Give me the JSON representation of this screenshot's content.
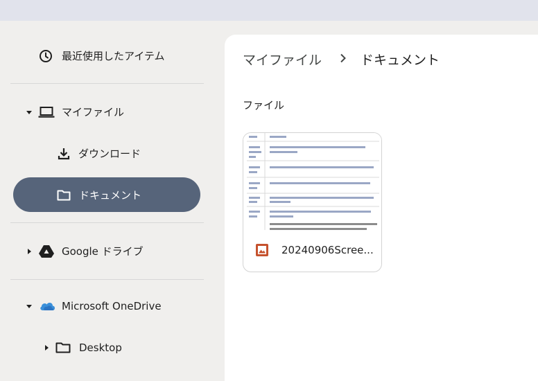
{
  "sidebar": {
    "recent": {
      "label": "最近使用したアイテム",
      "icon": "clock-icon"
    },
    "my_files": {
      "label": "マイファイル",
      "icon": "laptop-icon"
    },
    "downloads": {
      "label": "ダウンロード",
      "icon": "download-icon"
    },
    "documents": {
      "label": "ドキュメント",
      "icon": "folder-icon",
      "active": true
    },
    "google_drive": {
      "label": "Google ドライブ",
      "icon": "google-drive-icon"
    },
    "onedrive": {
      "label": "Microsoft OneDrive",
      "icon": "cloud-icon"
    },
    "desktop": {
      "label": "Desktop",
      "icon": "folder-icon"
    }
  },
  "main": {
    "breadcrumb": [
      "マイファイル",
      "ドキュメント"
    ],
    "section_label": "ファイル",
    "files": [
      {
        "name": "20240906Scree...",
        "icon": "image-file-icon"
      }
    ]
  },
  "colors": {
    "active_pill": "#56647a",
    "topbar": "#e1e3ec",
    "sidebar_bg": "#f0efed",
    "image_icon": "#c5522e"
  }
}
